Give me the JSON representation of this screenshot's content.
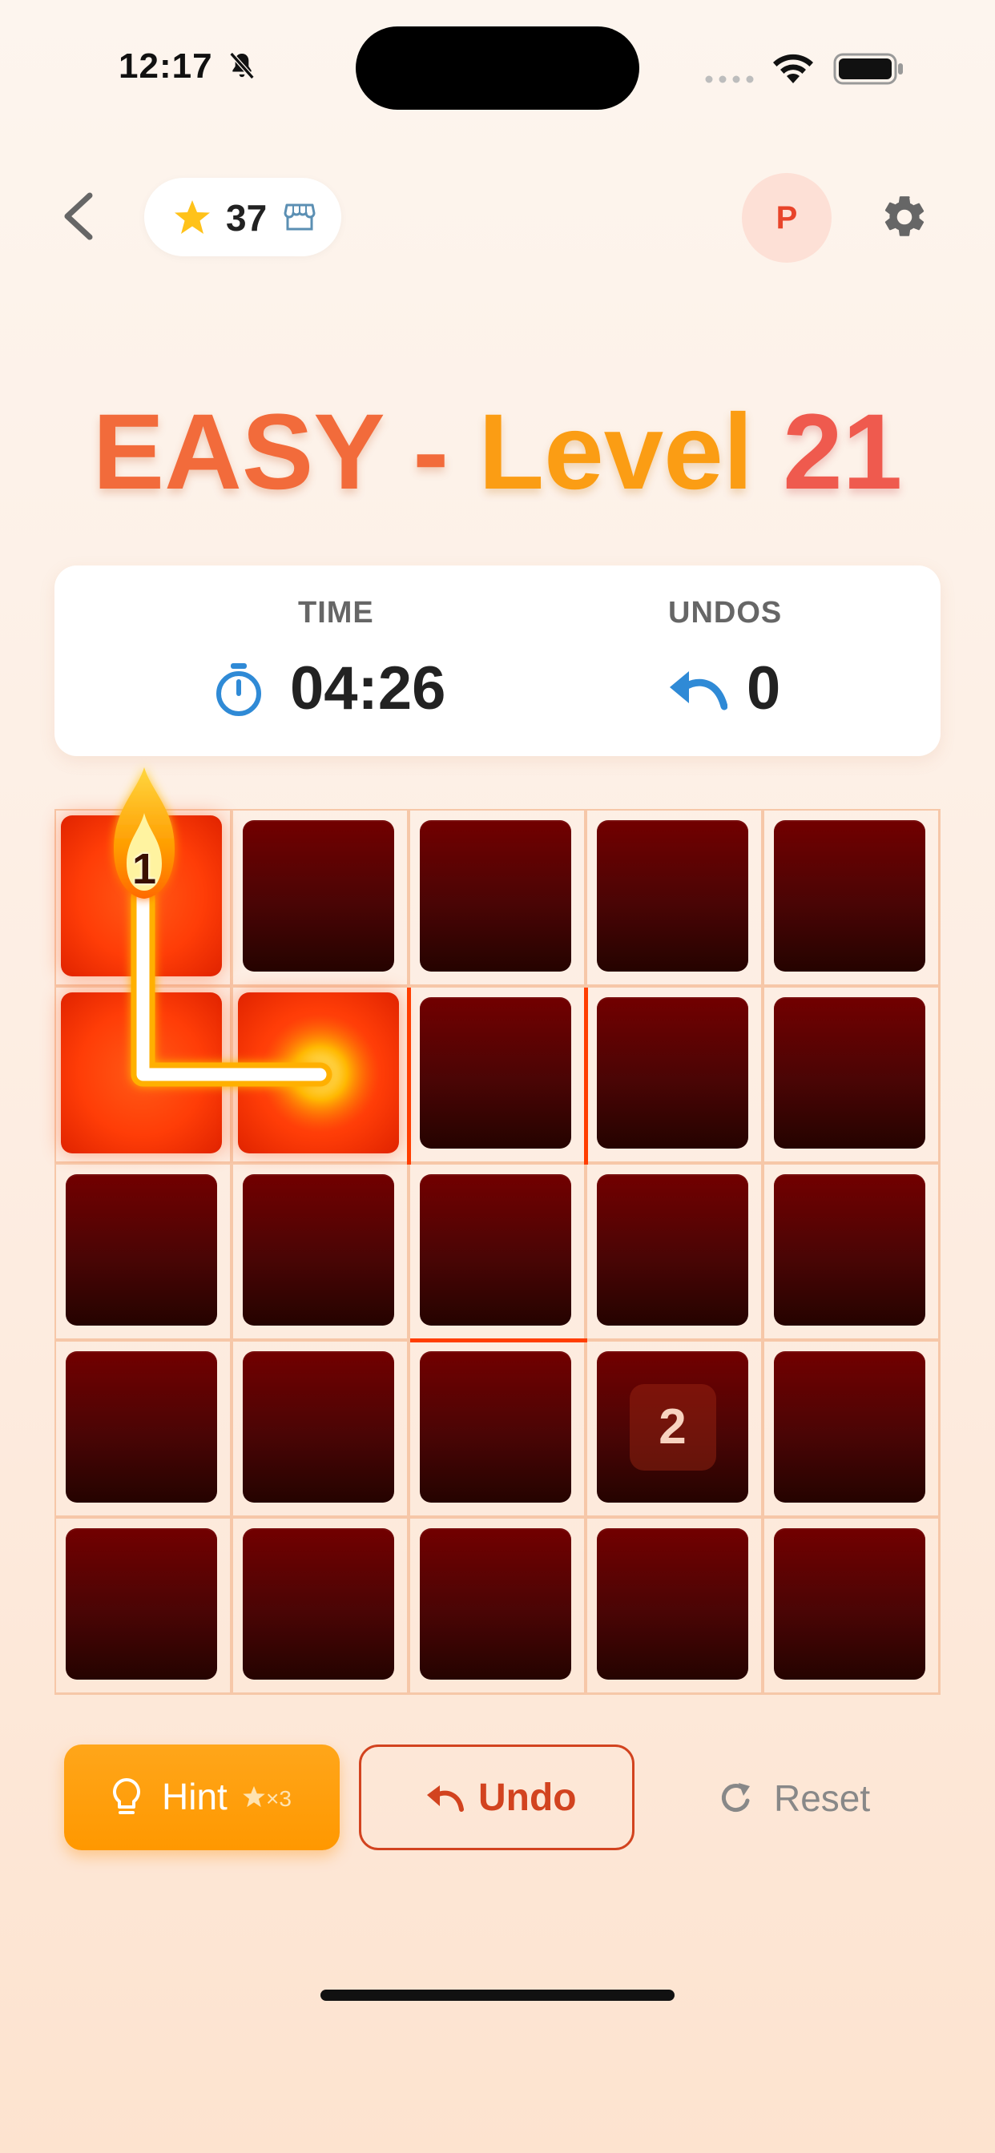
{
  "status_bar": {
    "time": "12:17"
  },
  "header": {
    "coins": "37",
    "avatar_initial": "P"
  },
  "title": {
    "difficulty": "EASY",
    "separator": "-",
    "level_label": "Level",
    "level_number": "21"
  },
  "stats": {
    "time_label": "TIME",
    "time_value": "04:26",
    "undos_label": "UNDOS",
    "undos_value": "0"
  },
  "board": {
    "rows": 5,
    "cols": 5,
    "clues": [
      {
        "row": 0,
        "col": 0,
        "value": "1"
      },
      {
        "row": 3,
        "col": 3,
        "value": "2"
      }
    ],
    "lit_cells": [
      [
        0,
        0
      ],
      [
        1,
        0
      ],
      [
        1,
        1
      ]
    ],
    "path": [
      [
        0,
        0
      ],
      [
        1,
        0
      ],
      [
        1,
        1
      ]
    ],
    "walls": [
      {
        "row": 1,
        "col": 1,
        "side": "right"
      },
      {
        "row": 1,
        "col": 2,
        "side": "right"
      },
      {
        "row": 2,
        "col": 2,
        "side": "bottom"
      }
    ]
  },
  "buttons": {
    "hint_label": "Hint",
    "hint_cost": "×3",
    "undo_label": "Undo",
    "reset_label": "Reset"
  },
  "colors": {
    "accent": "#ff9800",
    "danger": "#d2431f",
    "tile_dark": "#4a0505",
    "tile_lit": "#ff3d07"
  }
}
